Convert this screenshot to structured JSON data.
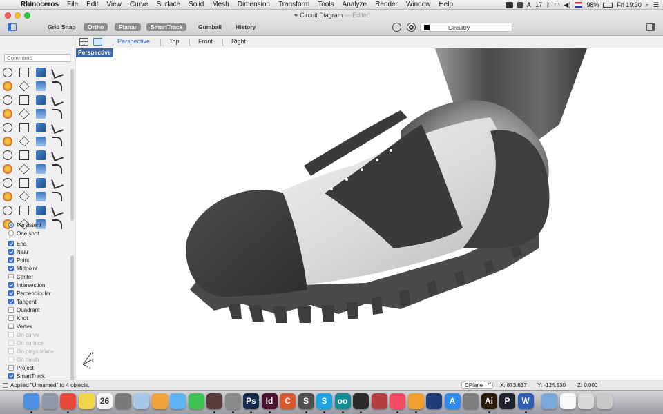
{
  "menubar": {
    "apple": "",
    "items": [
      "Rhinoceros",
      "File",
      "Edit",
      "View",
      "Curve",
      "Surface",
      "Solid",
      "Mesh",
      "Dimension",
      "Transform",
      "Tools",
      "Analyze",
      "Render",
      "Window",
      "Help"
    ],
    "tray": {
      "adobe_count": "17",
      "battery": "98%",
      "clock": "Fri 19:30"
    }
  },
  "window": {
    "title": "Circuit Diagram",
    "edited": "— Edited"
  },
  "toolbar": {
    "buttons": [
      {
        "label": "Grid Snap",
        "on": false
      },
      {
        "label": "Ortho",
        "on": true
      },
      {
        "label": "Planar",
        "on": true
      },
      {
        "label": "SmartTrack",
        "on": true
      },
      {
        "label": "Gumball",
        "on": false
      },
      {
        "label": "History",
        "on": false
      }
    ],
    "layer_name": "Circuitry"
  },
  "command": {
    "placeholder": "Command"
  },
  "osnap": {
    "mode": [
      {
        "label": "Persistent",
        "selected": true
      },
      {
        "label": "One shot",
        "selected": false
      }
    ],
    "snaps": [
      {
        "label": "End",
        "checked": true,
        "enabled": true
      },
      {
        "label": "Near",
        "checked": true,
        "enabled": true
      },
      {
        "label": "Point",
        "checked": true,
        "enabled": true
      },
      {
        "label": "Midpoint",
        "checked": true,
        "enabled": true
      },
      {
        "label": "Center",
        "checked": false,
        "enabled": true
      },
      {
        "label": "Intersection",
        "checked": true,
        "enabled": true
      },
      {
        "label": "Perpendicular",
        "checked": true,
        "enabled": true
      },
      {
        "label": "Tangent",
        "checked": true,
        "enabled": true
      },
      {
        "label": "Quadrant",
        "checked": false,
        "enabled": true
      },
      {
        "label": "Knot",
        "checked": false,
        "enabled": true
      },
      {
        "label": "Vertex",
        "checked": false,
        "enabled": true
      },
      {
        "label": "On curve",
        "checked": false,
        "enabled": false
      },
      {
        "label": "On surface",
        "checked": false,
        "enabled": false
      },
      {
        "label": "On polysurface",
        "checked": false,
        "enabled": false
      },
      {
        "label": "On mesh",
        "checked": false,
        "enabled": false
      },
      {
        "label": "Project",
        "checked": false,
        "enabled": true
      },
      {
        "label": "SmartTrack",
        "checked": true,
        "enabled": true
      }
    ]
  },
  "viewports": {
    "tabs": [
      {
        "label": "Perspective",
        "active": true
      },
      {
        "label": "Top",
        "active": false
      },
      {
        "label": "Front",
        "active": false
      },
      {
        "label": "Right",
        "active": false
      }
    ],
    "active_label": "Perspective"
  },
  "axis": {
    "x": "x",
    "y": "y",
    "z": "z"
  },
  "status": {
    "message": "Applied \"Unnamed\" to 4 objects.",
    "cplane": "CPlane",
    "x": "X: 873.637",
    "y": "Y: -124.530",
    "z": "Z: 0.000"
  },
  "dock": {
    "calendar_day": "26",
    "apps": [
      {
        "name": "finder-icon",
        "glyph": "",
        "color": "#4d8fe0"
      },
      {
        "name": "launchpad-icon",
        "glyph": "",
        "color": "#8f99a8"
      },
      {
        "name": "chrome-icon",
        "glyph": "",
        "color": "#e8493a"
      },
      {
        "name": "stickies-icon",
        "glyph": "",
        "color": "#f3d54a"
      },
      {
        "name": "calendar-icon",
        "glyph": "26",
        "color": "#f5f5f5"
      },
      {
        "name": "photo-booth-icon",
        "glyph": "",
        "color": "#7a7a7a"
      },
      {
        "name": "preview-icon",
        "glyph": "",
        "color": "#a8c7e8"
      },
      {
        "name": "photos-icon",
        "glyph": "",
        "color": "#f0a33b"
      },
      {
        "name": "messages-icon",
        "glyph": "",
        "color": "#5fb5f2"
      },
      {
        "name": "facetime-icon",
        "glyph": "",
        "color": "#3ec454"
      },
      {
        "name": "photo-app-icon",
        "glyph": "",
        "color": "#5a3a3a"
      },
      {
        "name": "rhino-icon",
        "glyph": "",
        "color": "#8a8a8a"
      },
      {
        "name": "photoshop-icon",
        "glyph": "Ps",
        "color": "#132a4d"
      },
      {
        "name": "indesign-icon",
        "glyph": "Id",
        "color": "#4a1230"
      },
      {
        "name": "creative-cloud-icon",
        "glyph": "C",
        "color": "#d6582d"
      },
      {
        "name": "sublime-icon",
        "glyph": "S",
        "color": "#4f4f4f"
      },
      {
        "name": "skype-icon",
        "glyph": "S",
        "color": "#1ba3e4"
      },
      {
        "name": "arduino-icon",
        "glyph": "oo",
        "color": "#138a93"
      },
      {
        "name": "equalizer-icon",
        "glyph": "",
        "color": "#2b2b2b"
      },
      {
        "name": "feather-icon",
        "glyph": "",
        "color": "#b33f3f"
      },
      {
        "name": "music-icon",
        "glyph": "",
        "color": "#f24a60"
      },
      {
        "name": "books-icon",
        "glyph": "",
        "color": "#f29e2e"
      },
      {
        "name": "sketch-icon",
        "glyph": "",
        "color": "#1d3e7a"
      },
      {
        "name": "app-store-icon",
        "glyph": "A",
        "color": "#2e8bf0"
      },
      {
        "name": "system-preferences-icon",
        "glyph": "",
        "color": "#7d7d7d"
      },
      {
        "name": "illustrator-icon",
        "glyph": "Ai",
        "color": "#2b1c09"
      },
      {
        "name": "p-app-icon",
        "glyph": "P",
        "color": "#1d2430"
      },
      {
        "name": "word-icon",
        "glyph": "W",
        "color": "#2d5fb5"
      },
      {
        "name": "airdrop-icon",
        "glyph": "",
        "color": "#7aa8d8"
      },
      {
        "name": "document-icon",
        "glyph": "",
        "color": "#f8f8f8"
      },
      {
        "name": "folder-icon",
        "glyph": "",
        "color": "#d8d8d8"
      },
      {
        "name": "trash-icon",
        "glyph": "",
        "color": "#c8c8c8"
      }
    ]
  }
}
